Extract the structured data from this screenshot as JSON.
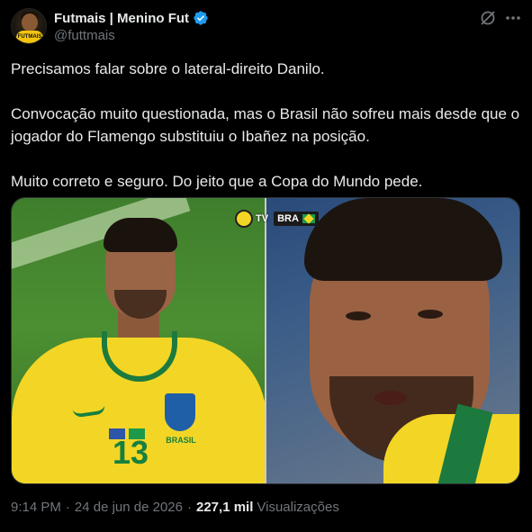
{
  "author": {
    "display_name": "Futmais | Menino Fut",
    "handle": "@futtmais",
    "avatar_text": "FUTMAIS"
  },
  "header_icons": {
    "grok": "grok-icon",
    "more": "more-icon"
  },
  "tweet": {
    "paragraphs": [
      "Precisamos falar sobre o lateral-direito Danilo.",
      "Convocação muito questionada, mas o Brasil não sofreu mais desde que o jogador do Flamengo substituiu o Ibañez na posição.",
      "Muito correto e seguro. Do jeito que a Copa do Mundo pede."
    ]
  },
  "media": {
    "shirt_number": "13",
    "crest_text": "BRASIL",
    "scorebug": {
      "channel": "TV",
      "team": "BRA"
    }
  },
  "meta": {
    "time": "9:14 PM",
    "date": "24 de jun de 2026",
    "views_count": "227,1 mil",
    "views_label": "Visualizações"
  },
  "colors": {
    "background": "#000000",
    "text_primary": "#e7e9ea",
    "text_secondary": "#71767b",
    "verified": "#1d9bf0",
    "jersey_yellow": "#f3d625",
    "jersey_green": "#17803f"
  }
}
